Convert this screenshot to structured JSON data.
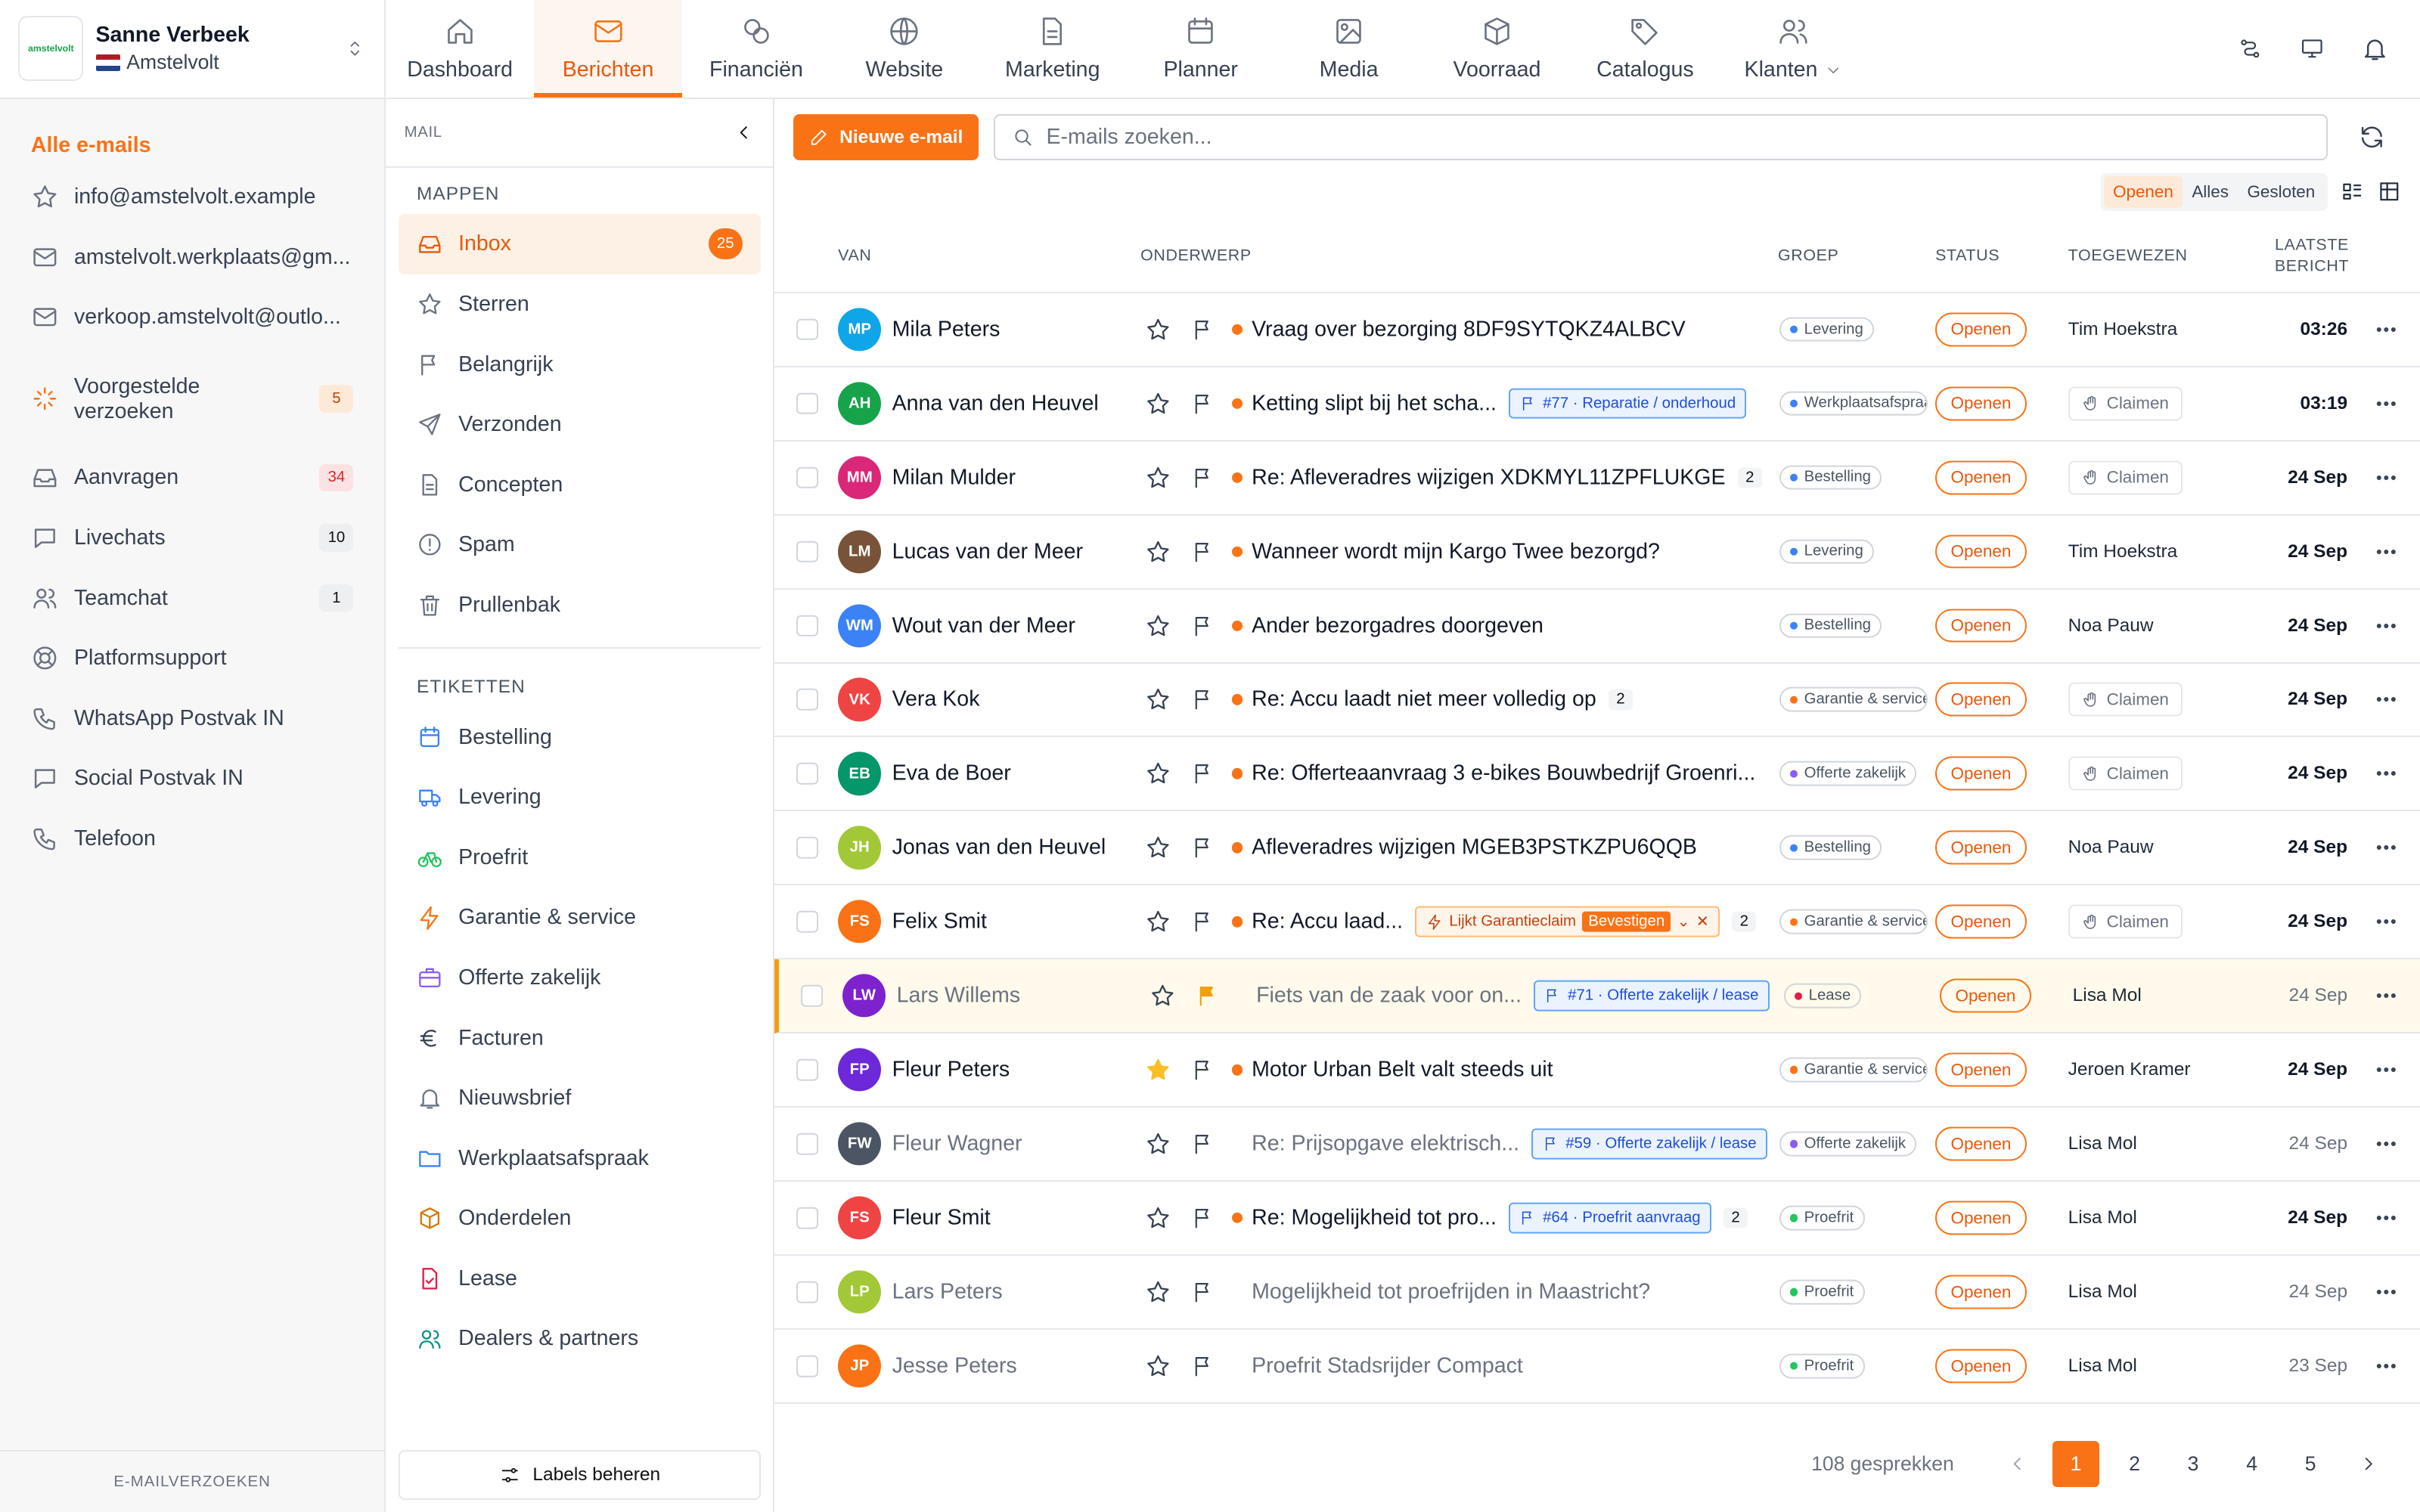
{
  "account": {
    "name": "Sanne Verbeek",
    "store": "Amstelvolt",
    "logo_text": "amstelvolt"
  },
  "nav": [
    {
      "label": "Dashboard",
      "icon": "home"
    },
    {
      "label": "Berichten",
      "icon": "mail",
      "active": true
    },
    {
      "label": "Financiën",
      "icon": "coins"
    },
    {
      "label": "Website",
      "icon": "globe"
    },
    {
      "label": "Marketing",
      "icon": "file"
    },
    {
      "label": "Planner",
      "icon": "calendar"
    },
    {
      "label": "Media",
      "icon": "image"
    },
    {
      "label": "Voorraad",
      "icon": "box"
    },
    {
      "label": "Catalogus",
      "icon": "tags"
    },
    {
      "label": "Klanten",
      "icon": "users"
    }
  ],
  "sidebar": {
    "all_label": "Alle e-mails",
    "accounts": [
      "info@amstelvolt.example",
      "amstelvolt.werkplaats@gm...",
      "verkoop.amstelvolt@outlo..."
    ],
    "suggested": {
      "label": "Voorgestelde verzoeken",
      "count": "5"
    },
    "items": [
      {
        "label": "Aanvragen",
        "count": "34",
        "icon": "inbox"
      },
      {
        "label": "Livechats",
        "count": "10",
        "icon": "chat"
      },
      {
        "label": "Teamchat",
        "count": "1",
        "icon": "users"
      },
      {
        "label": "Platformsupport",
        "count": "",
        "icon": "lifebuoy"
      },
      {
        "label": "WhatsApp Postvak IN",
        "count": "",
        "icon": "phone"
      },
      {
        "label": "Social Postvak IN",
        "count": "",
        "icon": "chat"
      },
      {
        "label": "Telefoon",
        "count": "",
        "icon": "phone"
      }
    ],
    "footer": "E-MAILVERZOEKEN"
  },
  "folders": {
    "header": "MAIL",
    "mappen_title": "MAPPEN",
    "mappen": [
      {
        "label": "Inbox",
        "count": "25",
        "icon": "inbox"
      },
      {
        "label": "Sterren",
        "icon": "star"
      },
      {
        "label": "Belangrijk",
        "icon": "flag"
      },
      {
        "label": "Verzonden",
        "icon": "send"
      },
      {
        "label": "Concepten",
        "icon": "file"
      },
      {
        "label": "Spam",
        "icon": "alert"
      },
      {
        "label": "Prullenbak",
        "icon": "trash"
      }
    ],
    "etiketten_title": "ETIKETTEN",
    "etiketten": [
      {
        "label": "Bestelling",
        "icon": "calendar",
        "color": "#3b82f6"
      },
      {
        "label": "Levering",
        "icon": "truck",
        "color": "#3b82f6"
      },
      {
        "label": "Proefrit",
        "icon": "bike",
        "color": "#22c55e"
      },
      {
        "label": "Garantie & service",
        "icon": "bolt",
        "color": "#f97316"
      },
      {
        "label": "Offerte zakelijk",
        "icon": "briefcase",
        "color": "#8b5cf6"
      },
      {
        "label": "Facturen",
        "icon": "euro",
        "color": "#374151"
      },
      {
        "label": "Nieuwsbrief",
        "icon": "bell",
        "color": "#6b7280"
      },
      {
        "label": "Werkplaatsafspraak",
        "icon": "folder",
        "color": "#3b82f6"
      },
      {
        "label": "Onderdelen",
        "icon": "box",
        "color": "#d97706"
      },
      {
        "label": "Lease",
        "icon": "filecheck",
        "color": "#e11d48"
      },
      {
        "label": "Dealers & partners",
        "icon": "users",
        "color": "#0d9488"
      }
    ],
    "manage_labels": "Labels beheren"
  },
  "toolbar": {
    "new_email": "Nieuwe e-mail",
    "search_placeholder": "E-mails zoeken...",
    "filters": [
      "Openen",
      "Alles",
      "Gesloten"
    ],
    "active_filter": "Openen"
  },
  "columns": {
    "van": "VAN",
    "onderwerp": "ONDERWERP",
    "groep": "GROEP",
    "status": "STATUS",
    "toegewezen": "TOEGEWEZEN",
    "laatste": "LAATSTE",
    "bericht": "BERICHT"
  },
  "emails": [
    {
      "initials": "MP",
      "name": "Mila Peters",
      "avatar": "#0ea5e9",
      "subject": "Vraag over bezorging 8DF9SYTQKZ4ALBCV",
      "unread": true,
      "group": "Levering",
      "group_color": "#3b82f6",
      "status": "Openen",
      "assigned": "Tim Hoekstra",
      "time": "03:26"
    },
    {
      "initials": "AH",
      "name": "Anna van den Heuvel",
      "avatar": "#16a34a",
      "subject": "Ketting slipt bij het scha...",
      "unread": true,
      "tag": "#77 · Reparatie / onderhoud",
      "group": "Werkplaatsafspraak",
      "group_color": "#3b82f6",
      "status": "Openen",
      "claim": "Claimen",
      "time": "03:19"
    },
    {
      "initials": "MM",
      "name": "Milan Mulder",
      "avatar": "#db2777",
      "subject": "Re: Afleveradres wijzigen XDKMYL11ZPFLUKGE",
      "unread": true,
      "num": "2",
      "group": "Bestelling",
      "group_color": "#3b82f6",
      "status": "Openen",
      "claim": "Claimen",
      "time": "24 Sep"
    },
    {
      "initials": "LM",
      "name": "Lucas van der Meer",
      "avatar": "#78533a",
      "subject": "Wanneer wordt mijn Kargo Twee bezorgd?",
      "unread": true,
      "group": "Levering",
      "group_color": "#3b82f6",
      "status": "Openen",
      "assigned": "Tim Hoekstra",
      "time": "24 Sep"
    },
    {
      "initials": "WM",
      "name": "Wout van der Meer",
      "avatar": "#3b82f6",
      "subject": "Ander bezorgadres doorgeven",
      "unread": true,
      "group": "Bestelling",
      "group_color": "#3b82f6",
      "status": "Openen",
      "assigned": "Noa Pauw",
      "time": "24 Sep"
    },
    {
      "initials": "VK",
      "name": "Vera Kok",
      "avatar": "#ef4444",
      "subject": "Re: Accu laadt niet meer volledig op",
      "unread": true,
      "num": "2",
      "group": "Garantie & service",
      "group_color": "#f97316",
      "status": "Openen",
      "claim": "Claimen",
      "time": "24 Sep"
    },
    {
      "initials": "EB",
      "name": "Eva de Boer",
      "avatar": "#059669",
      "subject": "Re: Offerteaanvraag 3 e-bikes Bouwbedrijf Groenri...",
      "unread": true,
      "group": "Offerte zakelijk",
      "group_color": "#8b5cf6",
      "status": "Openen",
      "claim": "Claimen",
      "time": "24 Sep"
    },
    {
      "initials": "JH",
      "name": "Jonas van den Heuvel",
      "avatar": "#a3c837",
      "subject": "Afleveradres wijzigen MGEB3PSTKZPU6QQB",
      "unread": true,
      "group": "Bestelling",
      "group_color": "#3b82f6",
      "status": "Openen",
      "assigned": "Noa Pauw",
      "time": "24 Sep"
    },
    {
      "initials": "FS",
      "name": "Felix Smit",
      "avatar": "#f97316",
      "subject": "Re: Accu laad...",
      "unread": true,
      "gar": {
        "label": "Lijkt Garantieclaim",
        "action": "Bevestigen"
      },
      "num": "2",
      "group": "Garantie & service",
      "group_color": "#f97316",
      "status": "Openen",
      "claim": "Claimen",
      "time": "24 Sep"
    },
    {
      "initials": "LW",
      "name": "Lars Willems",
      "avatar": "#7e22ce",
      "subject": "Fiets van de zaak voor on...",
      "unread": false,
      "highlight": true,
      "flagged": true,
      "tag": "#71 · Offerte zakelijk / lease",
      "group": "Lease",
      "group_color": "#e11d48",
      "status": "Openen",
      "assigned": "Lisa Mol",
      "time": "24 Sep"
    },
    {
      "initials": "FP",
      "name": "Fleur Peters",
      "avatar": "#6d28d9",
      "subject": "Motor Urban Belt valt steeds uit",
      "unread": true,
      "starred": true,
      "group": "Garantie & service",
      "group_color": "#f97316",
      "status": "Openen",
      "assigned": "Jeroen Kramer",
      "time": "24 Sep"
    },
    {
      "initials": "FW",
      "name": "Fleur Wagner",
      "avatar": "#4b5563",
      "subject": "Re: Prijsopgave elektrisch...",
      "unread": false,
      "tag": "#59 · Offerte zakelijk / lease",
      "group": "Offerte zakelijk",
      "group_color": "#8b5cf6",
      "status": "Openen",
      "assigned": "Lisa Mol",
      "time": "24 Sep"
    },
    {
      "initials": "FS",
      "name": "Fleur Smit",
      "avatar": "#ef4444",
      "subject": "Re: Mogelijkheid tot pro...",
      "unread": true,
      "tag": "#64 · Proefrit aanvraag",
      "num": "2",
      "group": "Proefrit",
      "group_color": "#22c55e",
      "status": "Openen",
      "assigned": "Lisa Mol",
      "time": "24 Sep"
    },
    {
      "initials": "LP",
      "name": "Lars Peters",
      "avatar": "#a3c837",
      "subject": "Mogelijkheid tot proefrijden in Maastricht?",
      "unread": false,
      "group": "Proefrit",
      "group_color": "#22c55e",
      "status": "Openen",
      "assigned": "Lisa Mol",
      "time": "24 Sep"
    },
    {
      "initials": "JP",
      "name": "Jesse Peters",
      "avatar": "#f97316",
      "subject": "Proefrit Stadsrijder Compact",
      "unread": false,
      "group": "Proefrit",
      "group_color": "#22c55e",
      "status": "Openen",
      "assigned": "Lisa Mol",
      "time": "23 Sep"
    }
  ],
  "pagination": {
    "total": "108 gesprekken",
    "pages": [
      "1",
      "2",
      "3",
      "4",
      "5"
    ],
    "current": "1"
  }
}
